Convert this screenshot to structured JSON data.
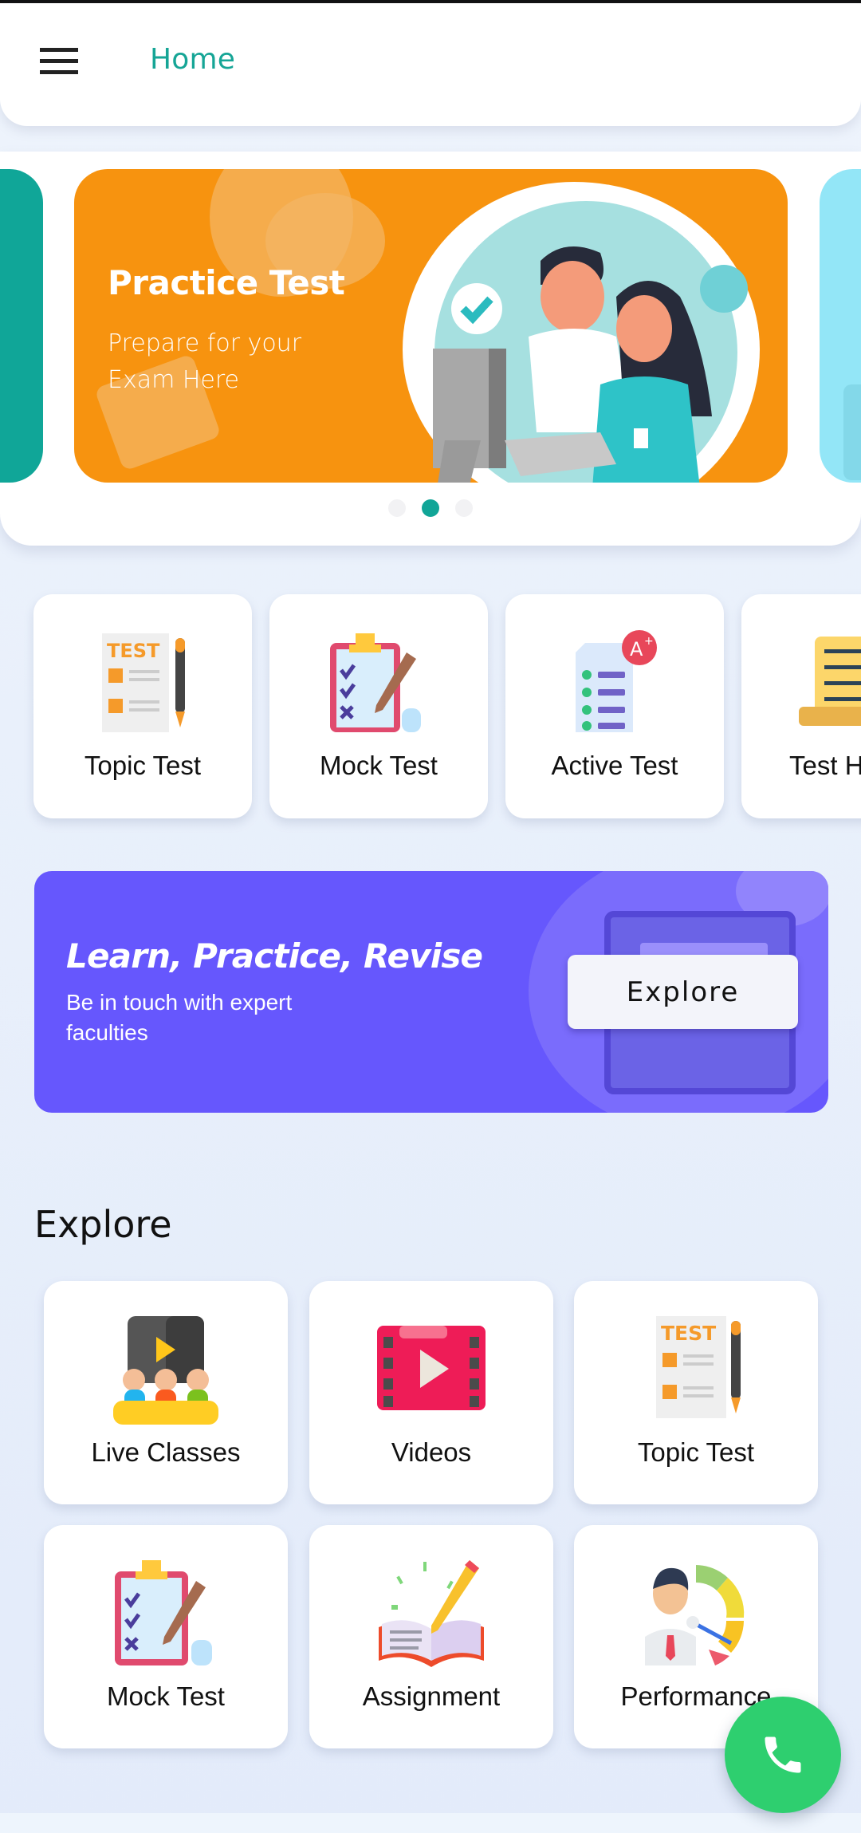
{
  "header": {
    "menu_icon": "hamburger-menu-icon",
    "title": "Home"
  },
  "carousel": {
    "active_index": 1,
    "slide_count": 3,
    "slides": [
      {
        "color": "#10a698"
      },
      {
        "title": "Practice Test",
        "subtitle": "Prepare for your Exam Here",
        "color": "#f7930f"
      },
      {
        "color": "#93e6f7"
      }
    ]
  },
  "quick_tiles": [
    {
      "label": "Topic Test",
      "icon": "test-sheet-icon"
    },
    {
      "label": "Mock Test",
      "icon": "clipboard-checklist-icon"
    },
    {
      "label": "Active Test",
      "icon": "grade-a-plus-icon"
    },
    {
      "label": "Test History",
      "icon": "scroll-history-icon"
    }
  ],
  "promo": {
    "title": "Learn, Practice, Revise",
    "subtitle": "Be in touch with expert faculties",
    "button_label": "Explore",
    "color": "#6657fd"
  },
  "explore": {
    "title": "Explore",
    "items": [
      {
        "label": "Live Classes",
        "icon": "live-class-icon"
      },
      {
        "label": "Videos",
        "icon": "video-film-icon"
      },
      {
        "label": "Topic Test",
        "icon": "test-sheet-icon"
      },
      {
        "label": "Mock Test",
        "icon": "clipboard-checklist-icon"
      },
      {
        "label": "Assignment",
        "icon": "book-pencil-icon"
      },
      {
        "label": "Performance",
        "icon": "performance-gauge-icon"
      }
    ]
  },
  "fab": {
    "icon": "phone-icon",
    "color": "#2ecf6f"
  },
  "colors": {
    "accent": "#16a596",
    "background": "#e9f0fb"
  }
}
